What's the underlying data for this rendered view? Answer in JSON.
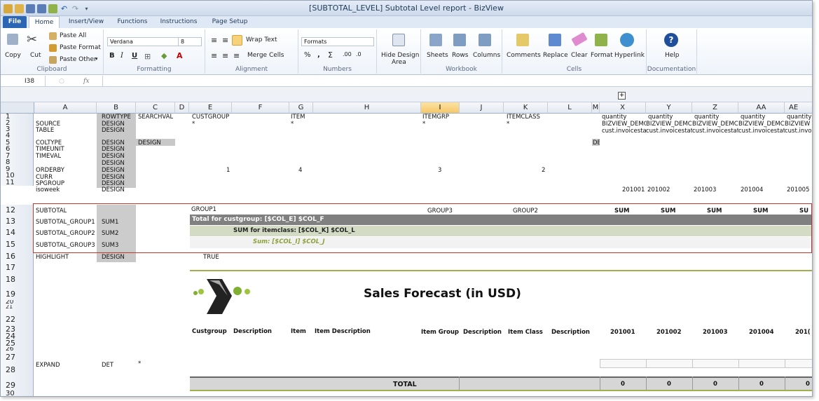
{
  "window": {
    "title": "[SUBTOTAL_LEVEL] Subtotal Level report - BizView"
  },
  "tabs": [
    "File",
    "Home",
    "Insert/View",
    "Functions",
    "Instructions",
    "Page Setup"
  ],
  "ribbon": {
    "clipboard": {
      "copy": "Copy",
      "cut": "Cut",
      "paste_all": "Paste All",
      "paste_format": "Paste Format",
      "paste_other": "Paste Other",
      "label": "Clipboard"
    },
    "formatting": {
      "font": "Verdana",
      "size": "8",
      "label": "Formatting"
    },
    "alignment": {
      "wrap": "Wrap Text",
      "merge": "Merge Cells",
      "label": "Alignment"
    },
    "numbers": {
      "formats": "Formats",
      "label": "Numbers"
    },
    "hide_design": {
      "label1": "Hide Design",
      "label2": "Area"
    },
    "workbook": {
      "sheets": "Sheets",
      "rows": "Rows",
      "columns": "Columns",
      "label": "Workbook"
    },
    "cells": {
      "comments": "Comments",
      "replace": "Replace",
      "clear": "Clear",
      "format": "Format",
      "hyperlink": "Hyperlink",
      "label": "Cells"
    },
    "documentation": {
      "help": "Help",
      "label": "Documentation"
    }
  },
  "formula_bar": {
    "cell": "I38",
    "fx": "fx"
  },
  "columns": [
    "A",
    "B",
    "C",
    "D",
    "E",
    "F",
    "G",
    "H",
    "I",
    "J",
    "K",
    "L",
    "M",
    "X",
    "Y",
    "Z",
    "AA",
    "AE"
  ],
  "rows": [
    "1",
    "2",
    "3",
    "4",
    "5",
    "6",
    "7",
    "8",
    "9",
    "10",
    "11",
    "12",
    "13",
    "14",
    "15",
    "16",
    "17",
    "18",
    "19",
    "20",
    "21",
    "22",
    "23",
    "24",
    "25",
    "26",
    "27",
    "28",
    "29",
    "30"
  ],
  "cells": {
    "b1": "ROWTYPE",
    "c1": "SEARCHVAL",
    "e1": "CUSTGROUP",
    "g1": "ITEM",
    "i1": "ITEMGRP",
    "k1": "ITEMCLASS",
    "x1": "quantity",
    "y1": "quantity",
    "z1": "quantity",
    "aa1": "quantity",
    "ae1": "quantity",
    "a2": "SOURCE",
    "b2": "DESIGN",
    "e2": "*",
    "g2": "*",
    "i2": "*",
    "k2": "*",
    "x2": "BIZVIEW_DEMC",
    "y2": "BIZVIEW_DEMC",
    "z2": "BIZVIEW_DEMC",
    "aa2": "BIZVIEW_DEMC",
    "ae2": "BIZVIEW",
    "a3": "TABLE",
    "b3": "DESIGN",
    "x3": "cust.invoicestat",
    "y3": "cust.invoicestat",
    "z3": "cust.invoicestat",
    "aa3": "cust.invoicestat",
    "ae3": "cust.invo",
    "a4": "COLTYPE",
    "b4": "DESIGN",
    "c4": "DESIGN",
    "m4": "DE",
    "a5": "TIMEUNIT",
    "b5": "DESIGN",
    "a6": "TIMEVAL",
    "b6": "DESIGN",
    "b7": "DESIGN",
    "a8": "ORDERBY",
    "b8": "DESIGN",
    "f8": "1",
    "g8": "4",
    "i8": "3",
    "k8": "2",
    "a9": "CURR",
    "b9": "DESIGN",
    "a10": "SPGROUP",
    "b10": "DESIGN",
    "a11": "isoweek",
    "b11": "DESIGN",
    "x11": "201001",
    "y11": "201002",
    "z11": "201003",
    "aa11": "201004",
    "ae11": "201005",
    "a12": "SUBTOTAL",
    "e12": "GROUP1",
    "i12": "GROUP3",
    "k12": "GROUP2",
    "x12": "SUM",
    "y12": "SUM",
    "z12": "SUM",
    "aa12": "SUM",
    "ae12": "SU",
    "a13": "SUBTOTAL_GROUP1",
    "b13": "SUM1",
    "e13": "Total for custgroup: [$COL_E] $COL_F",
    "a14": "SUBTOTAL_GROUP2",
    "b14": "SUM2",
    "e14": "SUM for itemclass: [$COL_K] $COL_L",
    "a15": "SUBTOTAL_GROUP3",
    "b15": "SUM3",
    "e15": "Sum: [$COL_I] $COL_J",
    "a16": "HIGHLIGHT",
    "b16": "DESIGN",
    "e16": "TRUE",
    "report_title": "Sales Forecast (in USD)",
    "h23": [
      "Custgroup",
      "Description",
      "Item",
      "Item Description",
      "Item Group",
      "Description",
      "Item Class",
      "Description",
      "201001",
      "201002",
      "201003",
      "201004",
      "201("
    ],
    "a27": "EXPAND",
    "b27": "DET",
    "c27": "*",
    "total": "TOTAL",
    "totals": [
      "0",
      "0",
      "0",
      "0",
      "0"
    ]
  }
}
